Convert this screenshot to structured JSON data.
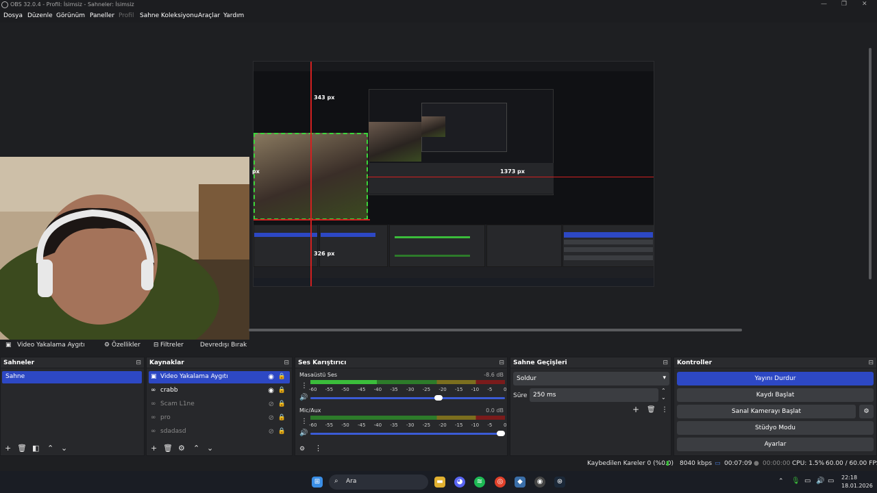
{
  "window": {
    "title": "OBS 32.0.4 - Profil: İsimsiz - Sahneler: İsimsiz"
  },
  "menu": [
    "Dosya",
    "Düzenle",
    "Görünüm",
    "Paneller",
    "Profil",
    "Sahne Koleksiyonu",
    "Araçlar",
    "Yardım"
  ],
  "preview": {
    "label_top": "343 px",
    "label_right": "1373 px",
    "label_bottom": "326 px",
    "label_left": "px"
  },
  "source_bar": {
    "source": "Video Yakalama Aygıtı",
    "properties": "Özellikler",
    "filters": "Filtreler",
    "deactivate": "Devredışı Bırak"
  },
  "scenes": {
    "title": "Sahneler",
    "items": [
      "Sahne"
    ]
  },
  "sources": {
    "title": "Kaynaklar",
    "items": [
      {
        "label": "Video Yakalama Aygıtı",
        "visible": true
      },
      {
        "label": "crabb",
        "visible": true
      },
      {
        "label": "Scam L1ne",
        "visible": false
      },
      {
        "label": "pro",
        "visible": false
      },
      {
        "label": "sdadasd",
        "visible": false
      }
    ]
  },
  "mixer": {
    "title": "Ses Karıştırıcı",
    "channels": [
      {
        "name": "Masaüstü Ses",
        "db": "-8.6 dB",
        "level": 0.34,
        "volume": 0.68
      },
      {
        "name": "Mic/Aux",
        "db": "0.0 dB",
        "level": 0.0,
        "volume": 1.0
      }
    ],
    "scale": [
      "-60",
      "-55",
      "-50",
      "-45",
      "-40",
      "-35",
      "-30",
      "-25",
      "-20",
      "-15",
      "-10",
      "-5",
      "0"
    ]
  },
  "transitions": {
    "title": "Sahne Geçişleri",
    "selected": "Soldur",
    "duration_label": "Süre",
    "duration": "250 ms"
  },
  "controls": {
    "title": "Kontroller",
    "buttons": [
      "Yayını Durdur",
      "Kaydı Başlat",
      "Sanal Kamerayı Başlat",
      "Stüdyo Modu",
      "Ayarlar"
    ]
  },
  "status": {
    "dropped": "Kaybedilen Kareler 0 (%0.0)",
    "bitrate": "8040 kbps",
    "stream_time": "00:07:09",
    "rec_time": "00:00:00",
    "cpu": "CPU: 1.5%",
    "fps": "60.00 / 60.00 FPS"
  },
  "taskbar": {
    "search": "Ara",
    "time": "22:18",
    "date": "18.01.2026"
  }
}
